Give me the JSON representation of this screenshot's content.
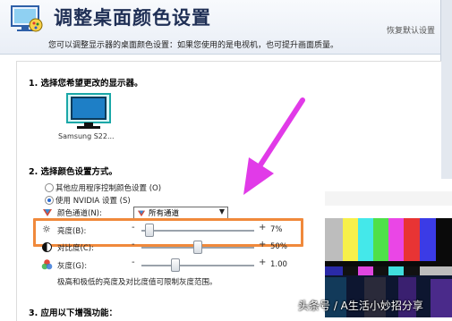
{
  "header": {
    "title": "调整桌面颜色设置",
    "restore_defaults": "恢复默认设置",
    "subtitle": "您可以调整显示器的桌面颜色设置：如果您使用的是电视机，也可提升画面质量。"
  },
  "section1": {
    "heading": "1. 选择您希望更改的显示器。",
    "monitor_label": "Samsung S22..."
  },
  "section2": {
    "heading": "2. 选择颜色设置方式。",
    "options": [
      {
        "label": "其他应用程序控制颜色设置 (O)",
        "selected": false
      },
      {
        "label": "使用 NVIDIA 设置 (S)",
        "selected": true
      }
    ],
    "channel_label": "颜色通道(N):",
    "channel_value": "所有通道",
    "brightness": {
      "label": "亮度(B):",
      "value": "7%",
      "level": 0.07
    },
    "contrast": {
      "label": "对比度(C):",
      "value": "50%",
      "level": 0.5
    },
    "gamma": {
      "label": "灰度(G):",
      "value": "1.00",
      "level": 0.3
    },
    "note": "极高和极低的亮度及对比度值可限制灰度范围。"
  },
  "section3": {
    "heading": "3. 应用以下增强功能："
  },
  "watermark": "头条号 / A生活小妙招分享",
  "colors": {
    "accent_orange": "#f0893b",
    "arrow_magenta": "#e13ae8",
    "title_blue": "#1f2f55"
  }
}
